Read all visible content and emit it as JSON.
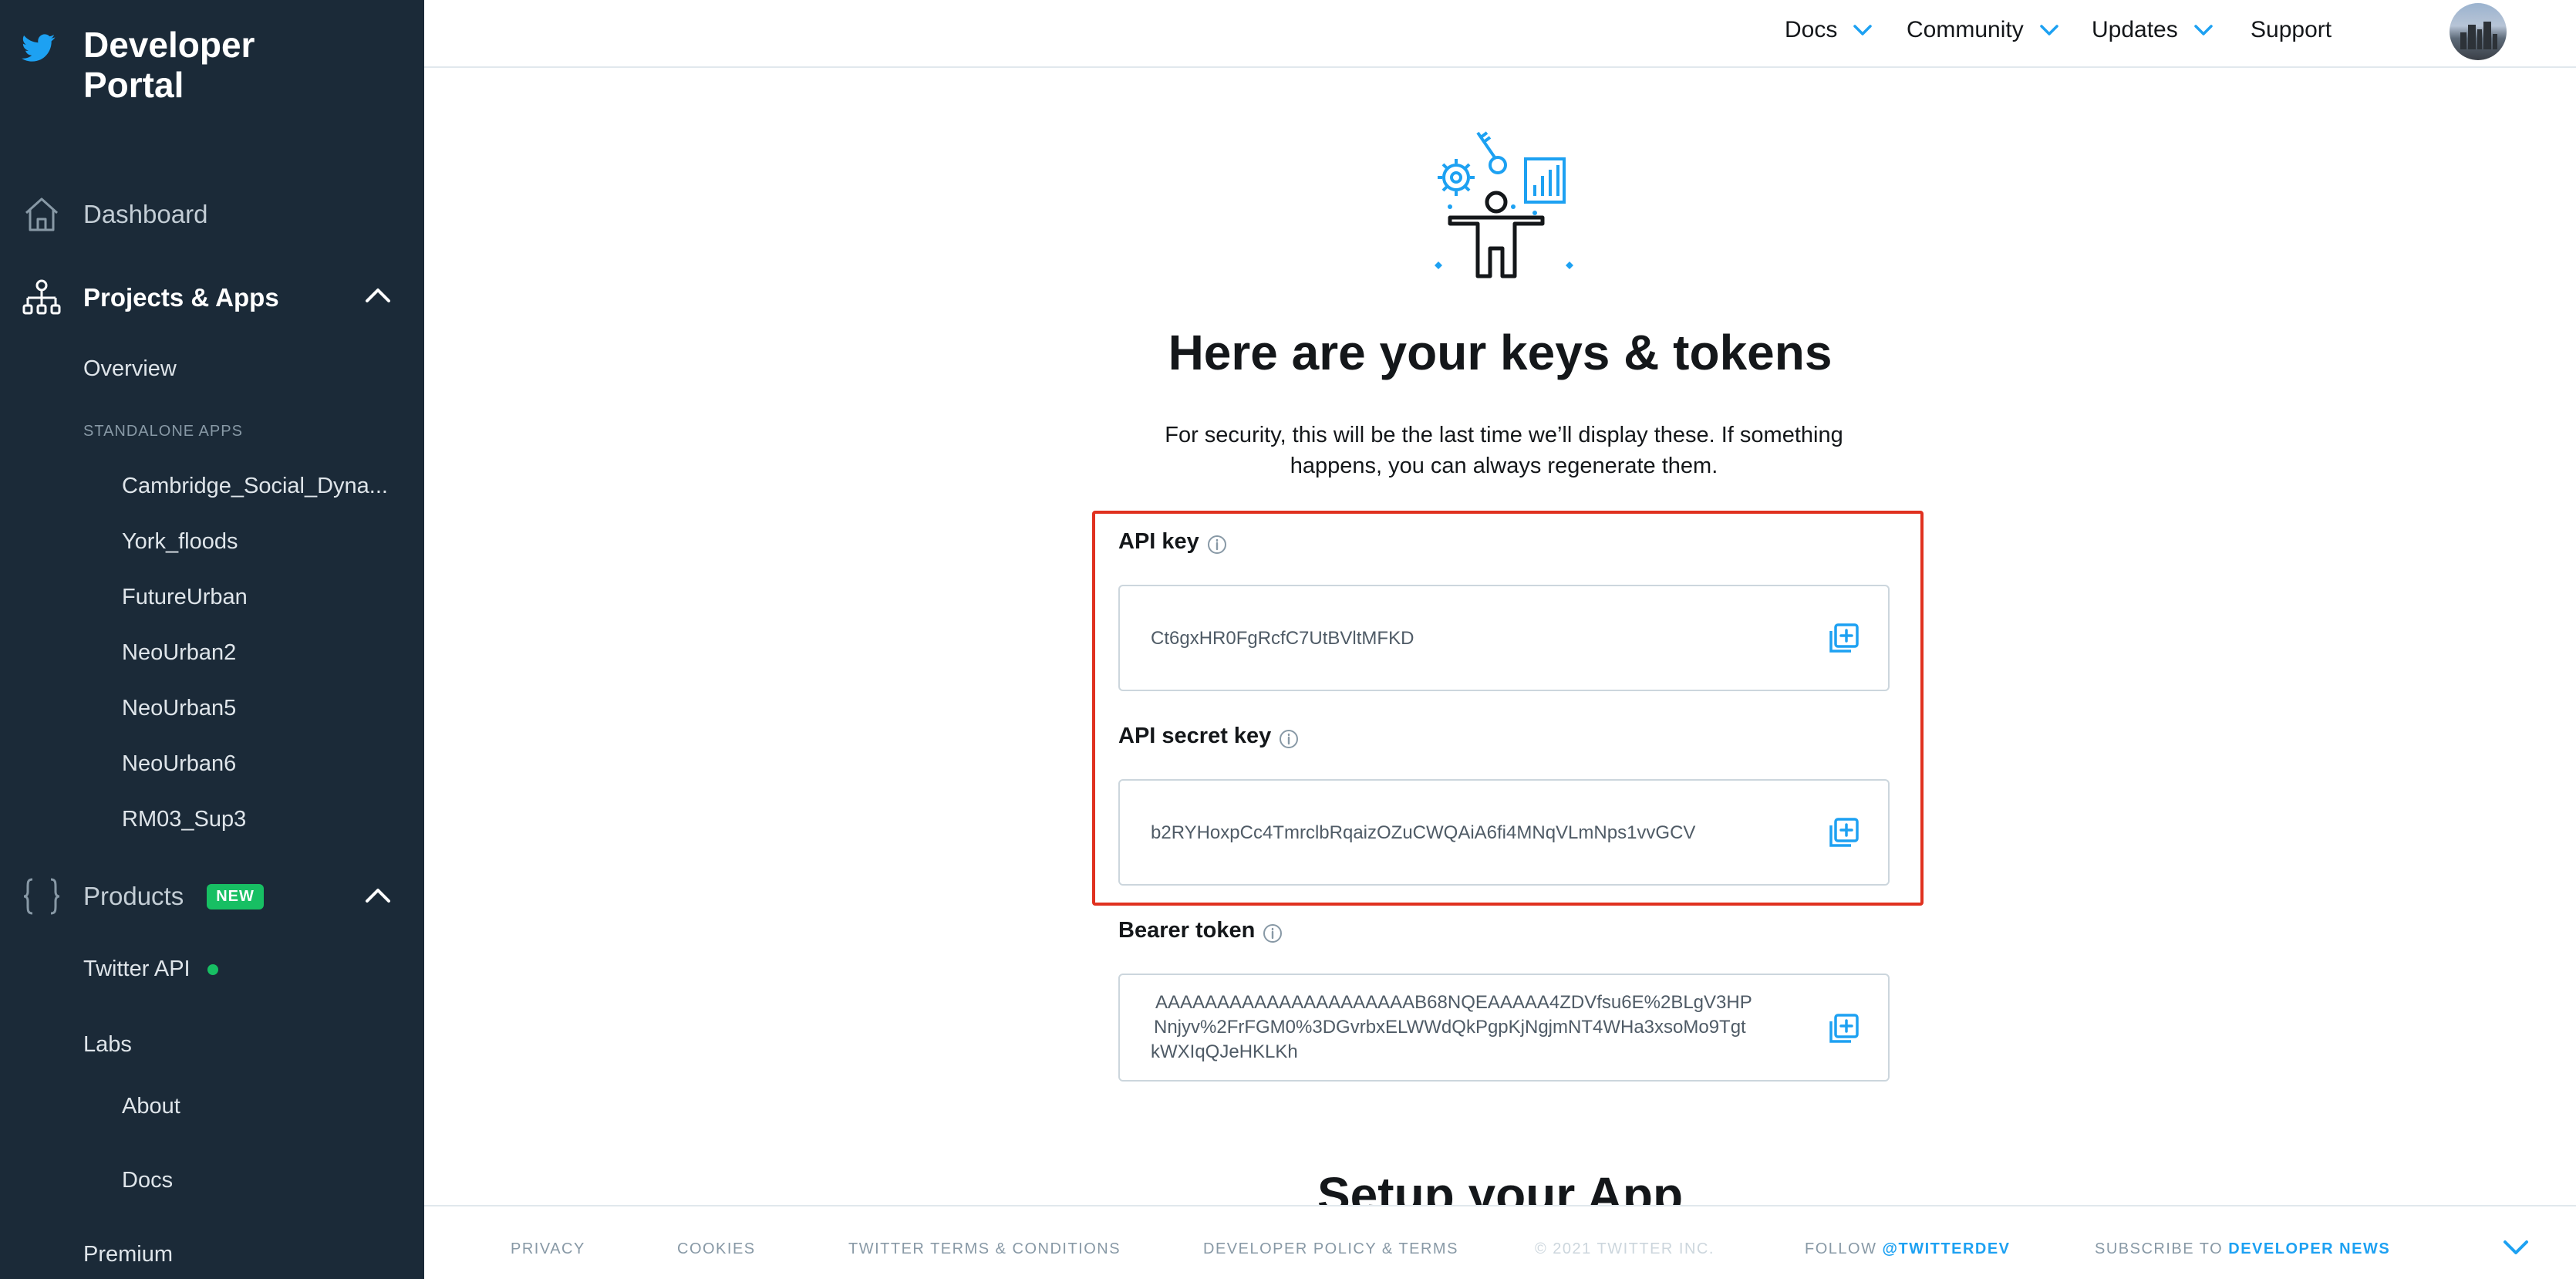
{
  "brand": {
    "title": "Developer Portal"
  },
  "sidebar": {
    "dashboard_label": "Dashboard",
    "projects_label": "Projects & Apps",
    "overview_label": "Overview",
    "standalone_caption": "STANDALONE APPS",
    "apps": [
      "Cambridge_Social_Dyna...",
      "York_floods",
      "FutureUrban",
      "NeoUrban2",
      "NeoUrban5",
      "NeoUrban6",
      "RM03_Sup3"
    ],
    "products_label": "Products",
    "new_badge": "NEW",
    "twitter_api_label": "Twitter API",
    "labs_label": "Labs",
    "about_label": "About",
    "docs_label": "Docs",
    "premium_label": "Premium"
  },
  "topnav": {
    "docs": "Docs",
    "community": "Community",
    "updates": "Updates",
    "support": "Support"
  },
  "main": {
    "heading": "Here are your keys & tokens",
    "subtext": "For security, this will be the last time we’ll display these. If something happens, you can always regenerate them.",
    "api_key_label": "API key",
    "api_key_value": "Ct6gxHR0FgRcfC7UtBVltMFKD",
    "api_secret_label": "API secret key",
    "api_secret_value": "b2RYHoxpCc4TmrclbRqaizOZuCWQAiA6fi4MNqVLmNps1vvGCV",
    "bearer_label": "Bearer token",
    "bearer_line1": "AAAAAAAAAAAAAAAAAAAAAB68NQEAAAAA4ZDVfsu6E%2BLgV3HP",
    "bearer_line2": "Nnjyv%2FrFGM0%3DGvrbxELWWdQkPgpKjNgjmNT4WHa3xsoMo9Tgt",
    "bearer_line3": "kWXIqQJeHKLKh",
    "setup_heading": "Setup your App"
  },
  "footer": {
    "privacy": "PRIVACY",
    "cookies": "COOKIES",
    "terms": "TWITTER TERMS & CONDITIONS",
    "policy": "DEVELOPER POLICY & TERMS",
    "copyright": "© 2021 TWITTER INC.",
    "follow_prefix": "FOLLOW",
    "follow_handle": "@TWITTERDEV",
    "subscribe_prefix": "SUBSCRIBE TO",
    "subscribe_link": "DEVELOPER NEWS"
  },
  "colors": {
    "sidebar_bg": "#1b2a38",
    "accent": "#1da1f2",
    "highlight": "#e0311f",
    "badge": "#17bf63"
  }
}
